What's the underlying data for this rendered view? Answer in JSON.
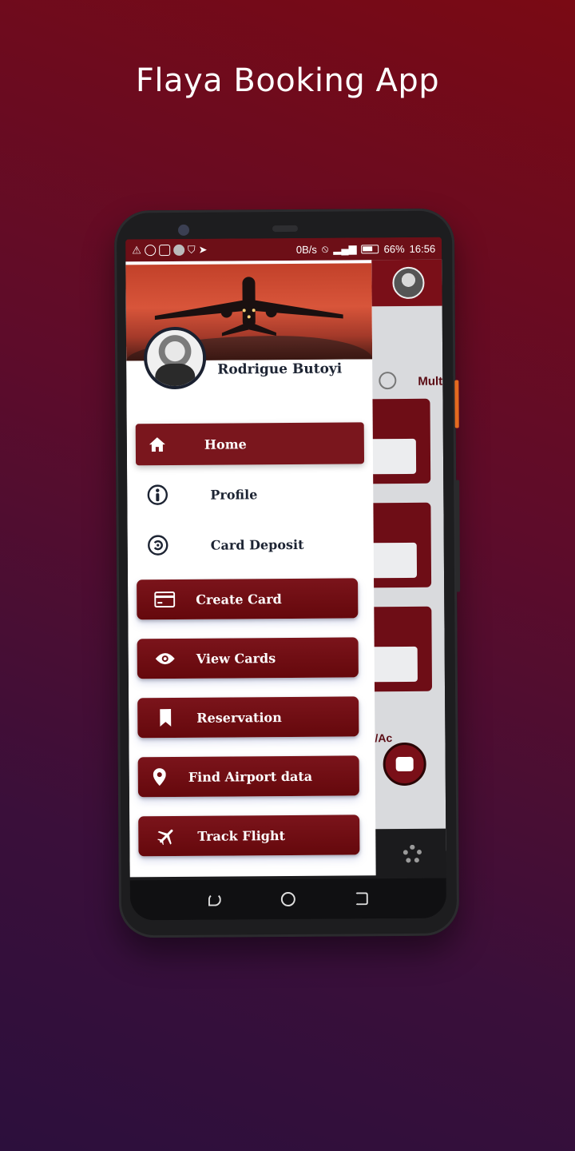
{
  "promo": {
    "title": "Flaya Booking App"
  },
  "status_bar": {
    "net_speed": "0B/s",
    "battery": "66%",
    "time": "16:56"
  },
  "background_app": {
    "trip_option": "Mult",
    "fab_partial": "/Ac"
  },
  "drawer": {
    "user_name": "Rodrigue Butoyi",
    "items": [
      {
        "label": "Home",
        "icon": "home-icon",
        "active": true
      },
      {
        "label": "Profile",
        "icon": "person-info-icon"
      },
      {
        "label": "Card Deposit",
        "icon": "deposit-icon"
      },
      {
        "label": "Create Card",
        "icon": "credit-card-icon"
      },
      {
        "label": "View Cards",
        "icon": "eye-icon"
      },
      {
        "label": "Reservation",
        "icon": "bookmark-icon"
      },
      {
        "label": "Find Airport data",
        "icon": "location-pin-icon"
      },
      {
        "label": "Track Flight",
        "icon": "airplane-icon"
      }
    ]
  },
  "colors": {
    "primary": "#7a161d",
    "status_bar": "#6d0f17",
    "text_dark": "#1d2433"
  }
}
